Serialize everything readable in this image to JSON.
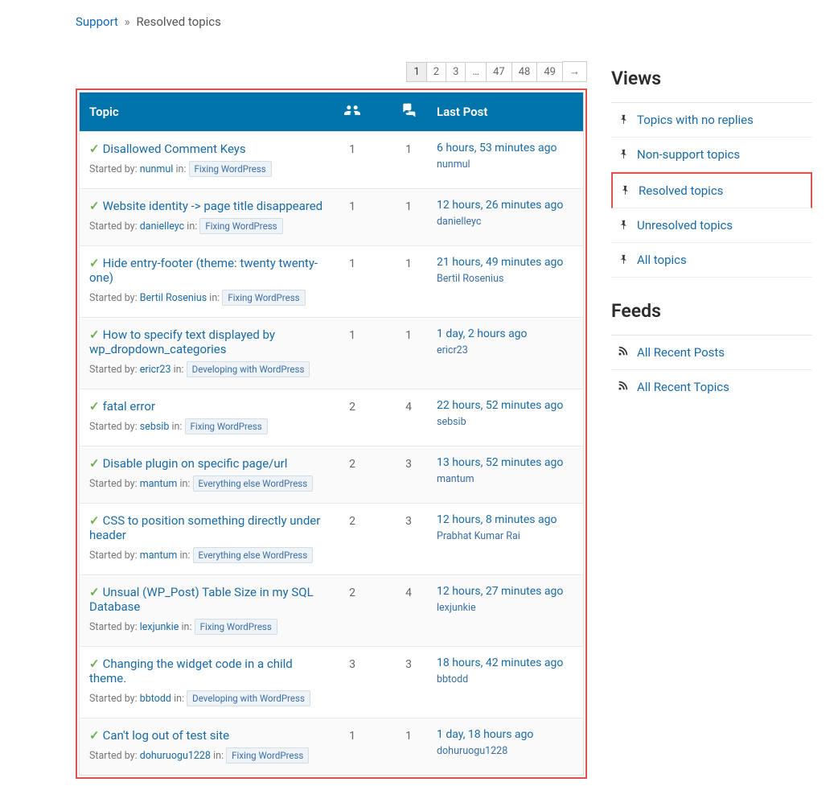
{
  "breadcrumb": {
    "root": "Support",
    "sep": "»",
    "current": "Resolved topics"
  },
  "pagination": [
    "1",
    "2",
    "3",
    "…",
    "47",
    "48",
    "49",
    "→"
  ],
  "table": {
    "cols": {
      "topic": "Topic",
      "last": "Last Post"
    },
    "started_by_label": "Started by:",
    "in_label": "in:"
  },
  "rows": [
    {
      "title": "Disallowed Comment Keys",
      "user": "nunmul",
      "forum": "Fixing WordPress",
      "voices": "1",
      "posts": "1",
      "time": "6 hours, 53 minutes ago",
      "last_user": "nunmul"
    },
    {
      "title": "Website identity -> page title disappeared",
      "user": "danielleyc",
      "forum": "Fixing WordPress",
      "voices": "1",
      "posts": "1",
      "time": "12 hours, 26 minutes ago",
      "last_user": "danielleyc"
    },
    {
      "title": "Hide entry-footer (theme: twenty twenty-one)",
      "user": "Bertil Rosenius",
      "forum": "Fixing WordPress",
      "voices": "1",
      "posts": "1",
      "time": "21 hours, 49 minutes ago",
      "last_user": "Bertil Rosenius"
    },
    {
      "title": "How to specify text displayed by wp_dropdown_categories",
      "user": "ericr23",
      "forum": "Developing with WordPress",
      "voices": "1",
      "posts": "1",
      "time": "1 day, 2 hours ago",
      "last_user": "ericr23"
    },
    {
      "title": "fatal error",
      "user": "sebsib",
      "forum": "Fixing WordPress",
      "voices": "2",
      "posts": "4",
      "time": "22 hours, 52 minutes ago",
      "last_user": "sebsib"
    },
    {
      "title": "Disable plugin on specific page/url",
      "user": "mantum",
      "forum": "Everything else WordPress",
      "voices": "2",
      "posts": "3",
      "time": "13 hours, 52 minutes ago",
      "last_user": "mantum"
    },
    {
      "title": "CSS to position something directly under header",
      "user": "mantum",
      "forum": "Everything else WordPress",
      "voices": "2",
      "posts": "3",
      "time": "12 hours, 8 minutes ago",
      "last_user": "Prabhat Kumar Rai"
    },
    {
      "title": "Unsual (WP_Post) Table Size in my SQL Database",
      "user": "lexjunkie",
      "forum": "Fixing WordPress",
      "voices": "2",
      "posts": "4",
      "time": "12 hours, 27 minutes ago",
      "last_user": "lexjunkie"
    },
    {
      "title": "Changing the widget code in a child theme.",
      "user": "bbtodd",
      "forum": "Developing with WordPress",
      "voices": "3",
      "posts": "3",
      "time": "18 hours, 42 minutes ago",
      "last_user": "bbtodd"
    },
    {
      "title": "Can't log out of test site",
      "user": "dohuruogu1228",
      "forum": "Fixing WordPress",
      "voices": "1",
      "posts": "1",
      "time": "1 day, 18 hours ago",
      "last_user": "dohuruogu1228"
    }
  ],
  "sidebar": {
    "views_heading": "Views",
    "feeds_heading": "Feeds",
    "views": [
      "Topics with no replies",
      "Non-support topics",
      "Resolved topics",
      "Unresolved topics",
      "All topics"
    ],
    "feeds": [
      "All Recent Posts",
      "All Recent Topics"
    ]
  }
}
